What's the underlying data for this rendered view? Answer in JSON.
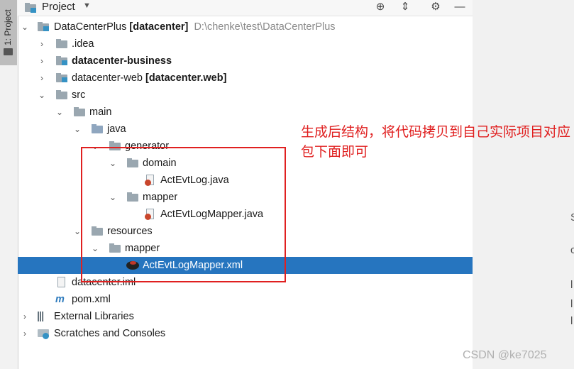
{
  "sidebar": {
    "tab_label": "1: Project"
  },
  "header": {
    "title": "Project",
    "caret": "▼",
    "target_icon": "⊕",
    "collapse_icon": "⇕",
    "settings_icon": "⚙",
    "minimize_icon": "—"
  },
  "tree": {
    "root_name": "DataCenterPlus",
    "root_module": "[datacenter]",
    "root_path": "D:\\chenke\\test\\DataCenterPlus",
    "idea": ".idea",
    "business": "datacenter-business",
    "web_name": "datacenter-web",
    "web_module": "[datacenter.web]",
    "src": "src",
    "main": "main",
    "java": "java",
    "generator": "generator",
    "domain": "domain",
    "act_evt_log": "ActEvtLog.java",
    "mapper": "mapper",
    "act_evt_log_mapper_java": "ActEvtLogMapper.java",
    "resources": "resources",
    "res_mapper": "mapper",
    "act_evt_log_mapper_xml": "ActEvtLogMapper.xml",
    "iml": "datacenter.iml",
    "pom": "pom.xml",
    "external_libraries": "External Libraries",
    "scratches": "Scratches and Consoles"
  },
  "annotation": {
    "text": "生成后结构，将代码拷贝到自己实际项目对应包下面即可",
    "color": "#e02020"
  },
  "watermark": "CSDN @ke7025",
  "right_edge_chars": [
    "S",
    "c",
    "l",
    "l",
    "l"
  ],
  "colors": {
    "selection": "#2675bf",
    "folder": "#9aa7b0",
    "module": "#3592c4",
    "java_cup": "#c9462c"
  }
}
